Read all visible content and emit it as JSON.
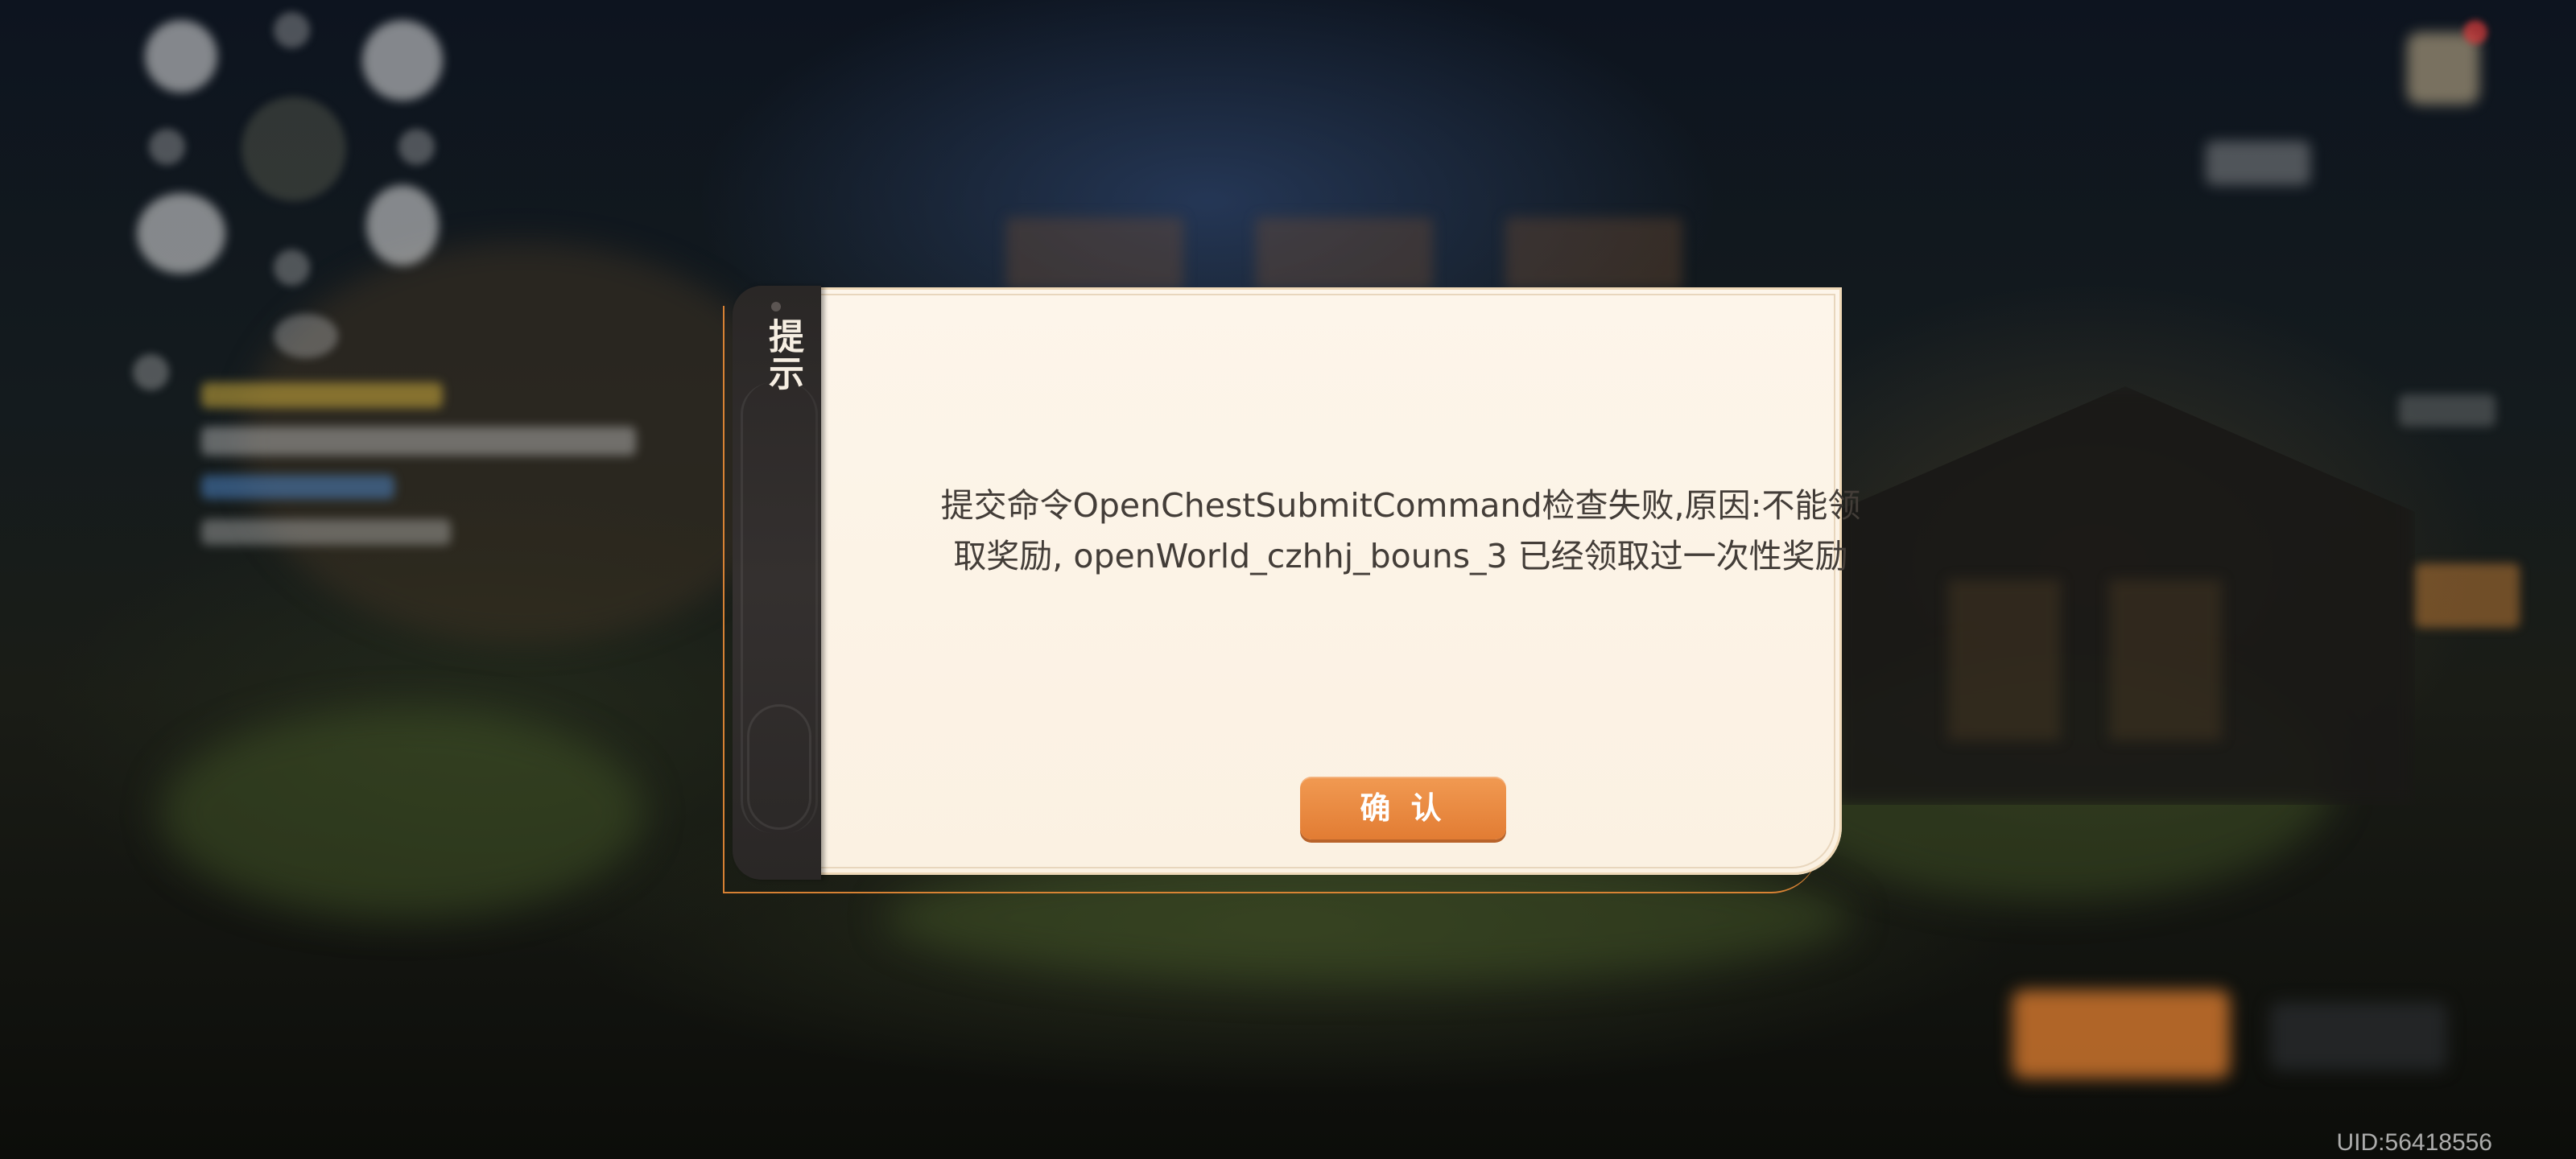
{
  "hud": {
    "uid_text": "UID:56418556"
  },
  "dialog": {
    "title": "提示",
    "message": "提交命令OpenChestSubmitCommand检查失败,原因:不能领取奖励, openWorld_czhhj_bouns_3 已经领取过一次性奖励",
    "confirm_label": "确 认"
  },
  "colors": {
    "accent_orange": "#e8843a",
    "dialog_background": "#fdf5ea",
    "side_tab": "#2d2a29",
    "message_text": "#433d38"
  }
}
